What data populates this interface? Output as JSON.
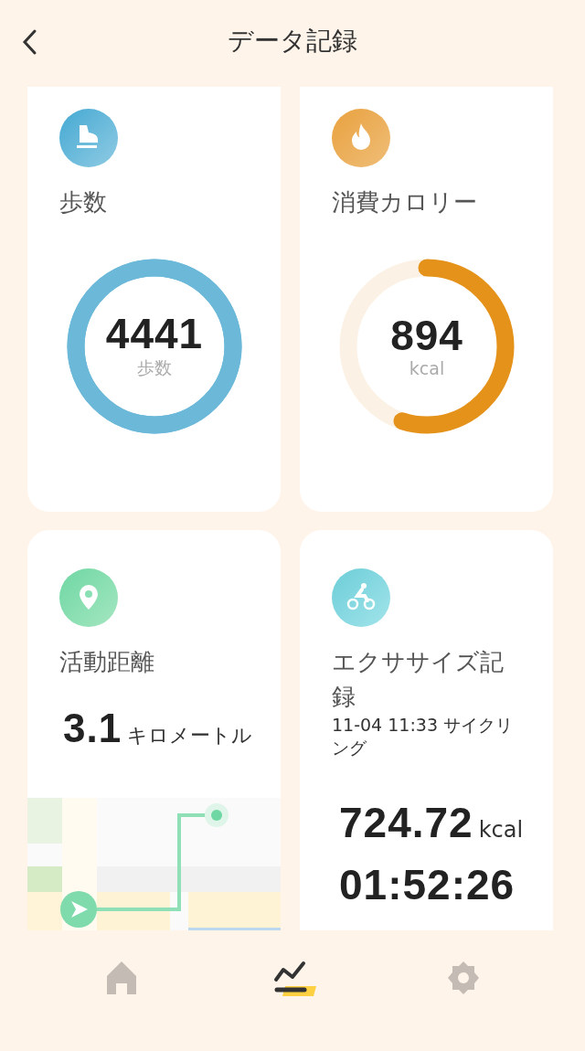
{
  "header": {
    "title": "データ記録"
  },
  "cards": [
    {
      "kind": "ring",
      "title": "歩数",
      "value": "4441",
      "unit": "歩数"
    },
    {
      "kind": "ring",
      "title": "消費カロリー",
      "value": "894",
      "unit": "kcal"
    },
    {
      "kind": "distance",
      "title": "活動距離",
      "value": "3.1",
      "unit": "キロメートル"
    },
    {
      "kind": "exercise",
      "title": "エクササイズ記録",
      "subtitle": "11-04 11:33 サイクリング",
      "calories": "724.72",
      "calories_unit": "kcal",
      "duration": "01:52:26"
    }
  ],
  "nav": [
    {
      "selected": false
    },
    {
      "selected": true
    },
    {
      "selected": false
    }
  ]
}
